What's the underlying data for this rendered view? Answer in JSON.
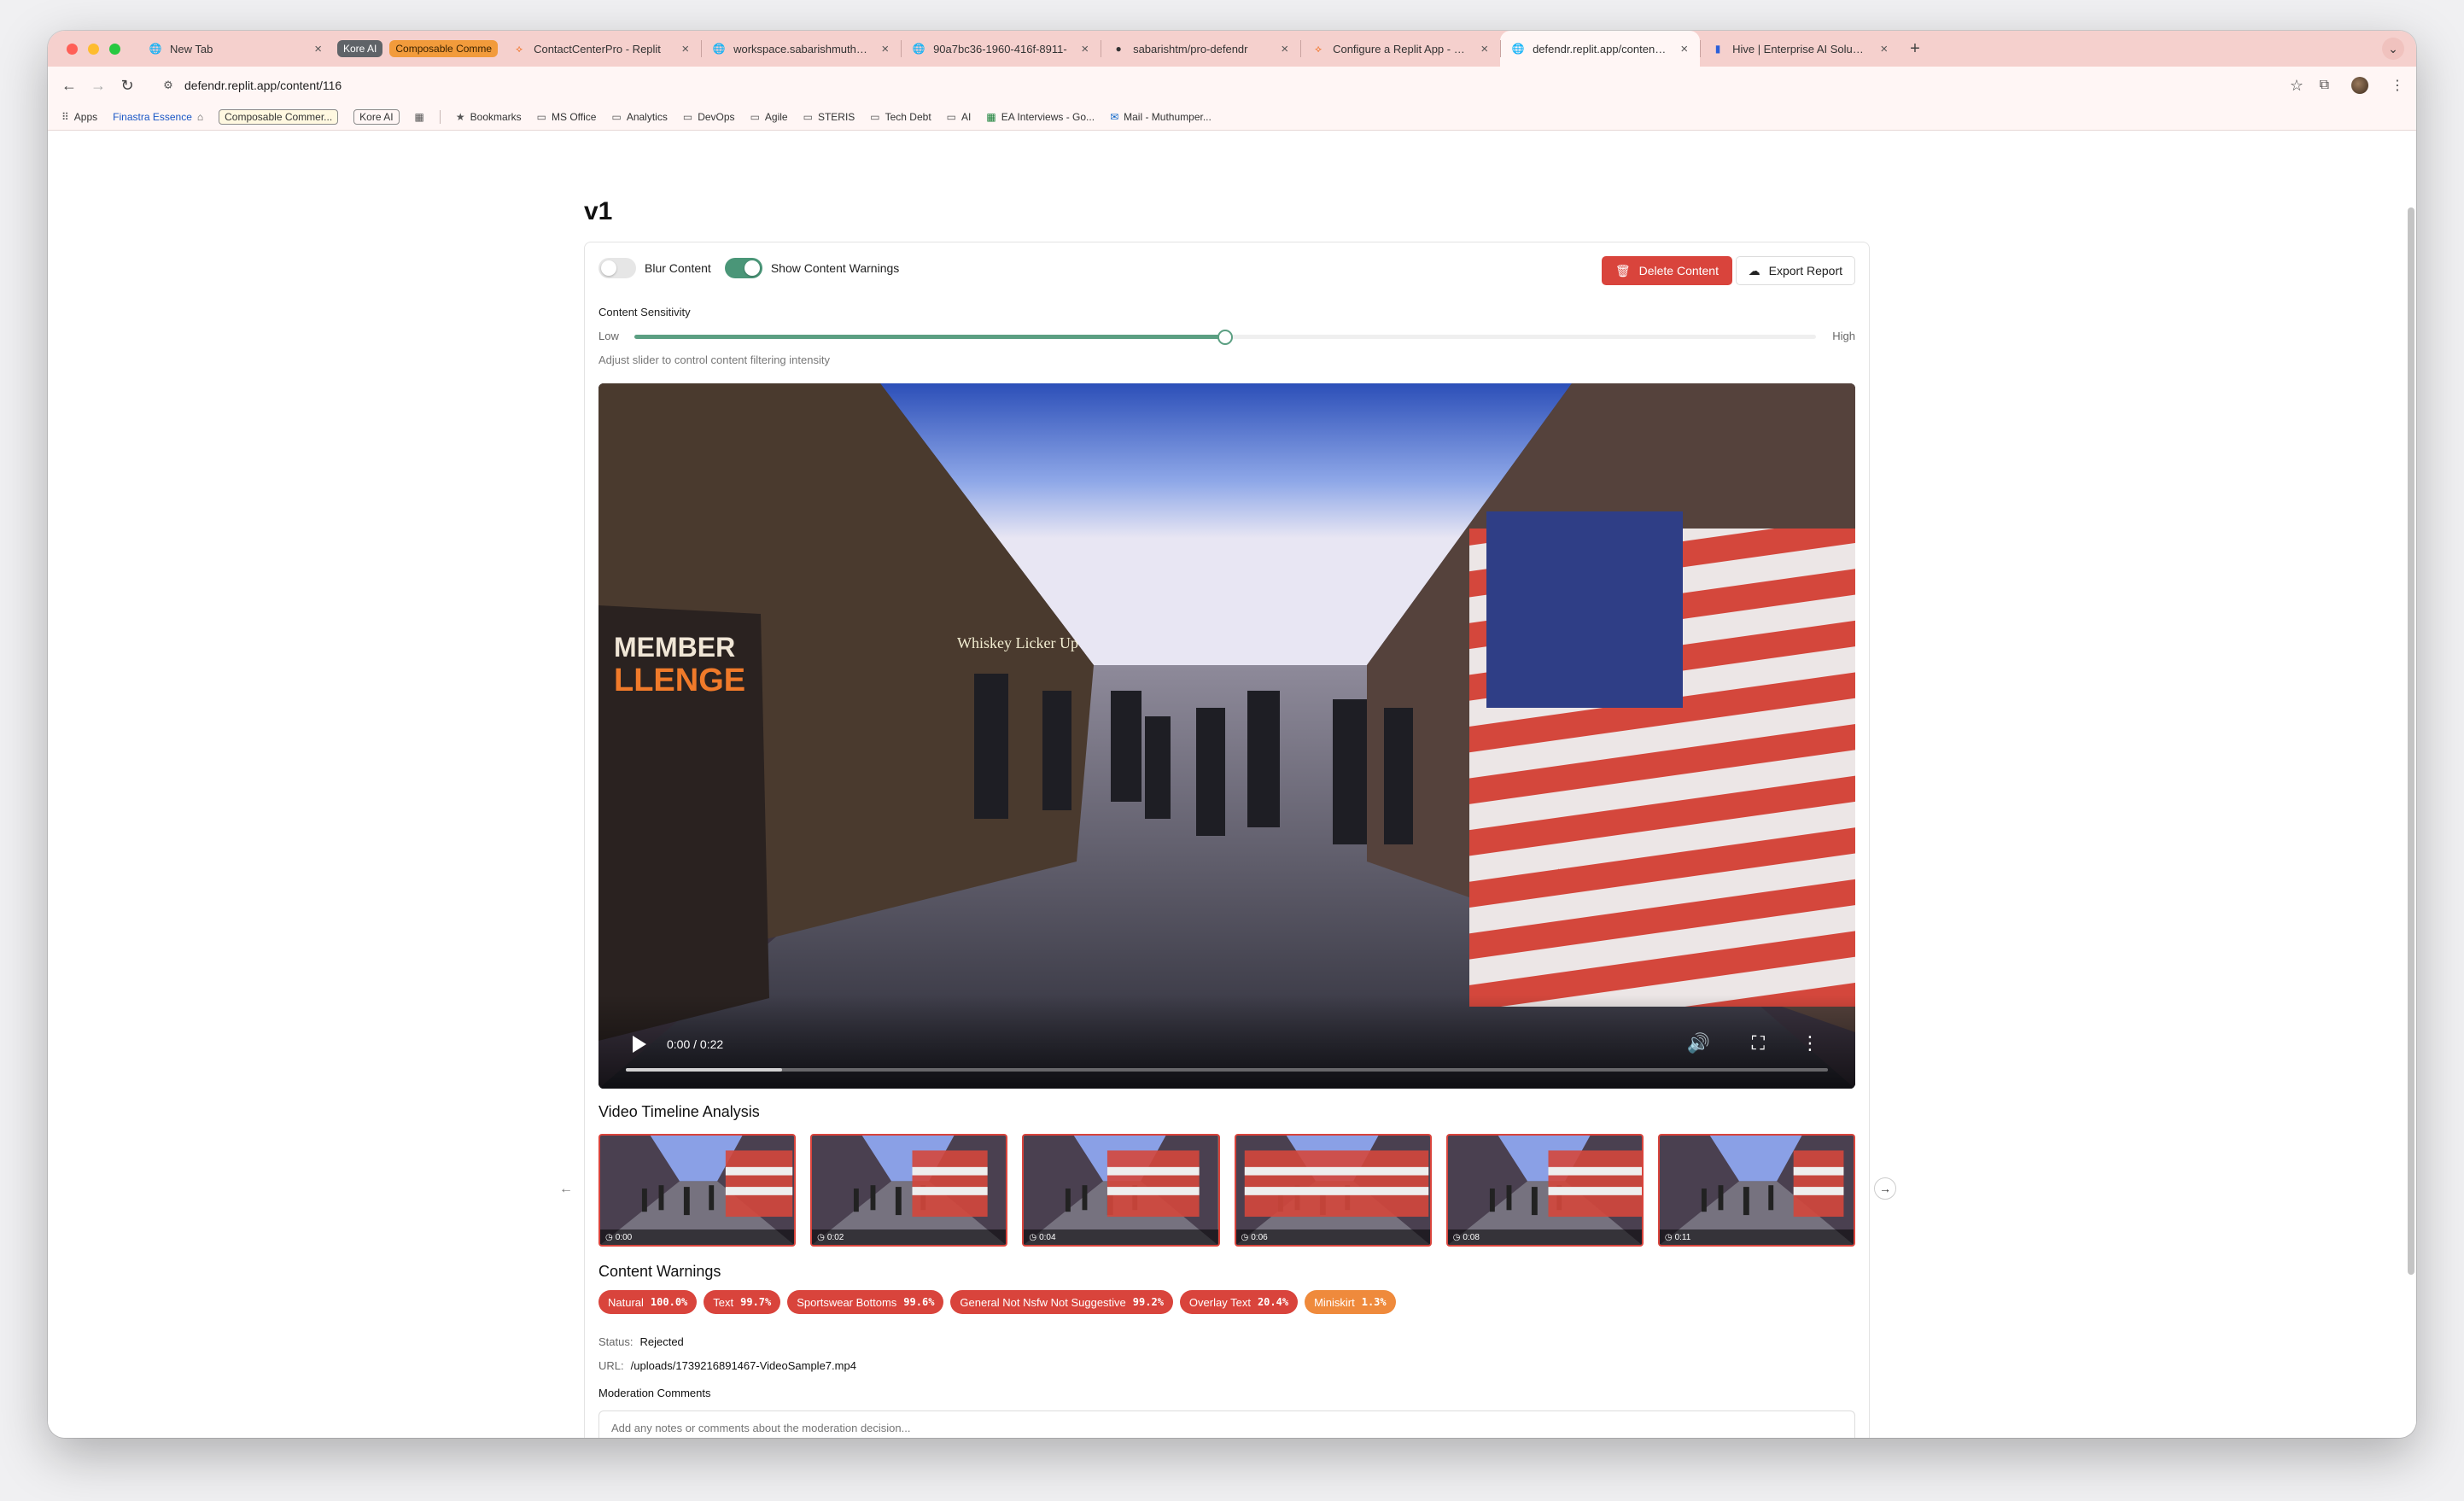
{
  "browser": {
    "tabs": [
      {
        "title": "New Tab",
        "icon": "globe-icon",
        "active": false
      },
      {
        "group": "Kore AI",
        "group_color": "#5f6368"
      },
      {
        "group": "Composable Comme",
        "group_color": "#f29b3b"
      },
      {
        "title": "ContactCenterPro - Replit",
        "icon": "replit-icon",
        "active": false
      },
      {
        "title": "workspace.sabarishmuthump",
        "icon": "globe-icon",
        "active": false
      },
      {
        "title": "90a7bc36-1960-416f-8911-",
        "icon": "globe-icon",
        "active": false
      },
      {
        "title": "sabarishtm/pro-defendr",
        "icon": "github-icon",
        "active": false
      },
      {
        "title": "Configure a Replit App - Repl",
        "icon": "replit-icon",
        "active": false
      },
      {
        "title": "defendr.replit.app/content/11",
        "icon": "globe-icon",
        "active": true
      },
      {
        "title": "Hive | Enterprise AI Solutions",
        "icon": "hive-icon",
        "active": false
      }
    ],
    "url": "defendr.replit.app/content/116",
    "bookmarks": [
      {
        "label": "Apps",
        "icon": "apps-grid-icon",
        "style": "plain"
      },
      {
        "label": "Finastra Essence",
        "icon": "",
        "style": "blue"
      },
      {
        "label": "Composable Commer...",
        "icon": "",
        "style": "chip"
      },
      {
        "label": "Kore AI",
        "icon": "",
        "style": "chip"
      },
      {
        "label": "",
        "icon": "grid-icon",
        "style": "plain"
      },
      {
        "label": "Bookmarks",
        "icon": "star-icon",
        "style": "plain"
      },
      {
        "label": "MS Office",
        "icon": "folder-icon",
        "style": "plain"
      },
      {
        "label": "Analytics",
        "icon": "folder-icon",
        "style": "plain"
      },
      {
        "label": "DevOps",
        "icon": "folder-icon",
        "style": "plain"
      },
      {
        "label": "Agile",
        "icon": "folder-icon",
        "style": "plain"
      },
      {
        "label": "STERIS",
        "icon": "folder-icon",
        "style": "plain"
      },
      {
        "label": "Tech Debt",
        "icon": "folder-icon",
        "style": "plain"
      },
      {
        "label": "AI",
        "icon": "folder-icon",
        "style": "plain"
      },
      {
        "label": "EA Interviews - Go...",
        "icon": "sheets-icon",
        "style": "plain"
      },
      {
        "label": "Mail - Muthumper...",
        "icon": "outlook-icon",
        "style": "plain"
      }
    ]
  },
  "page": {
    "title": "v1",
    "blur_label": "Blur Content",
    "blur_on": false,
    "warnings_label": "Show Content Warnings",
    "warnings_on": true,
    "delete_label": "Delete Content",
    "export_label": "Export Report",
    "sensitivity": {
      "label": "Content Sensitivity",
      "low": "Low",
      "high": "High",
      "value_fraction": 0.5,
      "help": "Adjust slider to control content filtering intensity"
    },
    "video": {
      "time": "0:00 / 0:22",
      "progress_fraction": 0,
      "buffered_fraction": 0.13
    },
    "timeline": {
      "heading": "Video Timeline Analysis",
      "frames": [
        {
          "time": "0:00"
        },
        {
          "time": "0:02"
        },
        {
          "time": "0:04"
        },
        {
          "time": "0:06"
        },
        {
          "time": "0:08"
        },
        {
          "time": "0:11"
        }
      ]
    },
    "warnings": {
      "heading": "Content Warnings",
      "items": [
        {
          "label": "Natural",
          "pct": "100.0%",
          "color": "red"
        },
        {
          "label": "Text",
          "pct": "99.7%",
          "color": "red"
        },
        {
          "label": "Sportswear Bottoms",
          "pct": "99.6%",
          "color": "red"
        },
        {
          "label": "General Not Nsfw Not Suggestive",
          "pct": "99.2%",
          "color": "red"
        },
        {
          "label": "Overlay Text",
          "pct": "20.4%",
          "color": "red"
        },
        {
          "label": "Miniskirt",
          "pct": "1.3%",
          "color": "orange"
        }
      ]
    },
    "status_label": "Status:",
    "status_value": "Rejected",
    "url_label": "URL:",
    "url_value": "/uploads/1739216891467-VideoSample7.mp4",
    "comments_label": "Moderation Comments",
    "comments_placeholder": "Add any notes or comments about the moderation decision..."
  },
  "colors": {
    "accent_green": "#4a9678",
    "danger_red": "#d9443c",
    "warning_orange": "#ef8a3c",
    "tabstrip_pink": "#f5d0cd"
  }
}
